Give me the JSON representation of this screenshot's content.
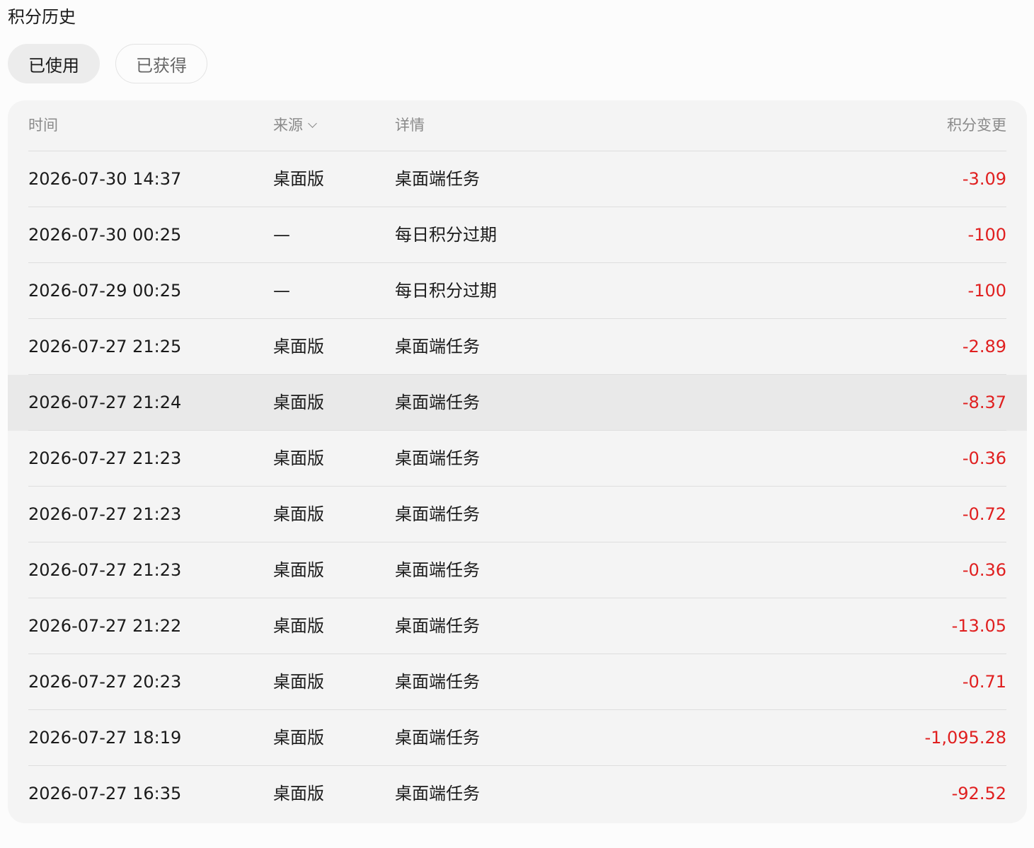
{
  "page_title": "积分历史",
  "tabs": [
    {
      "label": "已使用",
      "active": true
    },
    {
      "label": "已获得",
      "active": false
    }
  ],
  "table": {
    "headers": {
      "time": "时间",
      "source": "来源",
      "detail": "详情",
      "change": "积分变更"
    },
    "rows": [
      {
        "time": "2026-07-30 14:37",
        "source": "桌面版",
        "detail": "桌面端任务",
        "change": "-3.09"
      },
      {
        "time": "2026-07-30 00:25",
        "source": "—",
        "detail": "每日积分过期",
        "change": "-100"
      },
      {
        "time": "2026-07-29 00:25",
        "source": "—",
        "detail": "每日积分过期",
        "change": "-100"
      },
      {
        "time": "2026-07-27 21:25",
        "source": "桌面版",
        "detail": "桌面端任务",
        "change": "-2.89"
      },
      {
        "time": "2026-07-27 21:24",
        "source": "桌面版",
        "detail": "桌面端任务",
        "change": "-8.37"
      },
      {
        "time": "2026-07-27 21:23",
        "source": "桌面版",
        "detail": "桌面端任务",
        "change": "-0.36"
      },
      {
        "time": "2026-07-27 21:23",
        "source": "桌面版",
        "detail": "桌面端任务",
        "change": "-0.72"
      },
      {
        "time": "2026-07-27 21:23",
        "source": "桌面版",
        "detail": "桌面端任务",
        "change": "-0.36"
      },
      {
        "time": "2026-07-27 21:22",
        "source": "桌面版",
        "detail": "桌面端任务",
        "change": "-13.05"
      },
      {
        "time": "2026-07-27 20:23",
        "source": "桌面版",
        "detail": "桌面端任务",
        "change": "-0.71"
      },
      {
        "time": "2026-07-27 18:19",
        "source": "桌面版",
        "detail": "桌面端任务",
        "change": "-1,095.28"
      },
      {
        "time": "2026-07-27 16:35",
        "source": "桌面版",
        "detail": "桌面端任务",
        "change": "-92.52"
      }
    ]
  },
  "colors": {
    "negative_change": "#e01f1f",
    "hover_row": "#e9e9e9",
    "card_bg": "#f4f4f4"
  }
}
